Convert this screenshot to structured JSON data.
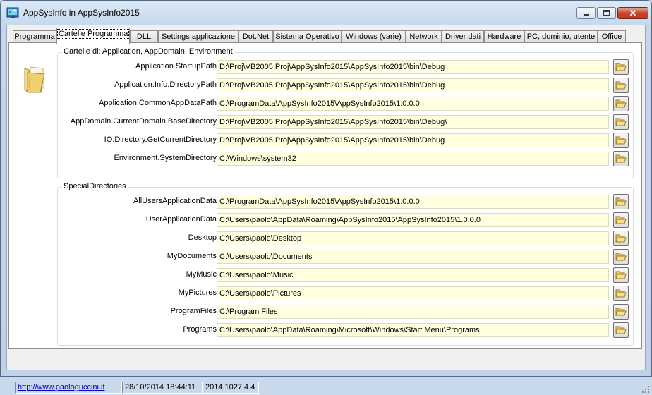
{
  "window": {
    "title": "AppSysInfo in AppSysInfo2015"
  },
  "controls": {
    "minimize": "minimize",
    "maximize": "maximize",
    "close": "✕"
  },
  "tabs": [
    {
      "label": "Programma"
    },
    {
      "label": "Cartelle Programma",
      "active": true
    },
    {
      "label": "DLL"
    },
    {
      "label": "Settings applicazione"
    },
    {
      "label": "Dot.Net"
    },
    {
      "label": "Sistema Operativo"
    },
    {
      "label": "Windows (varie)"
    },
    {
      "label": "Network"
    },
    {
      "label": "Driver dati"
    },
    {
      "label": "Hardware"
    },
    {
      "label": "PC, dominio, utente"
    },
    {
      "label": "Office"
    }
  ],
  "groups": {
    "app_folders": {
      "legend": "Cartelle di: Application, AppDomain, Environment",
      "rows": [
        {
          "label": "Application.StartupPath",
          "value": "D:\\Proj\\VB2005 Proj\\AppSysInfo2015\\AppSysInfo2015\\bin\\Debug"
        },
        {
          "label": "Application.Info.DirectoryPath",
          "value": "D:\\Proj\\VB2005 Proj\\AppSysInfo2015\\AppSysInfo2015\\bin\\Debug"
        },
        {
          "label": "Application.CommonAppDataPath",
          "value": "C:\\ProgramData\\AppSysInfo2015\\AppSysInfo2015\\1.0.0.0"
        },
        {
          "label": "AppDomain.CurrentDomain.BaseDirectory",
          "value": "D:\\Proj\\VB2005 Proj\\AppSysInfo2015\\AppSysInfo2015\\bin\\Debug\\"
        },
        {
          "label": "IO.Directory.GetCurrentDirectory",
          "value": "D:\\Proj\\VB2005 Proj\\AppSysInfo2015\\AppSysInfo2015\\bin\\Debug"
        },
        {
          "label": "Environment.SystemDirectory",
          "value": "C:\\Windows\\system32"
        }
      ]
    },
    "special_dirs": {
      "legend": "SpecialDirectories",
      "rows": [
        {
          "label": "AllUsersApplicationData",
          "value": "C:\\ProgramData\\AppSysInfo2015\\AppSysInfo2015\\1.0.0.0"
        },
        {
          "label": "UserApplicationData",
          "value": "C:\\Users\\paolo\\AppData\\Roaming\\AppSysInfo2015\\AppSysInfo2015\\1.0.0.0"
        },
        {
          "label": "Desktop",
          "value": "C:\\Users\\paolo\\Desktop"
        },
        {
          "label": "MyDocuments",
          "value": "C:\\Users\\paolo\\Documents"
        },
        {
          "label": "MyMusic",
          "value": "C:\\Users\\paolo\\Music"
        },
        {
          "label": "MyPictures",
          "value": "C:\\Users\\paolo\\Pictures"
        },
        {
          "label": "ProgramFiles",
          "value": "C:\\Program Files"
        },
        {
          "label": "Programs",
          "value": "C:\\Users\\paolo\\AppData\\Roaming\\Microsoft\\Windows\\Start Menu\\Programs"
        }
      ]
    }
  },
  "icons": {
    "folder_button": "open-folder-icon",
    "header": "folder-icon"
  },
  "status": {
    "link": "http://www.paologuccini.it",
    "datetime": "28/10/2014 18:44:11",
    "version": "2014.1027.4.4"
  },
  "colors": {
    "field_bg": "#ffffe0",
    "link": "#0000cc",
    "close_button": "#c7462c"
  }
}
